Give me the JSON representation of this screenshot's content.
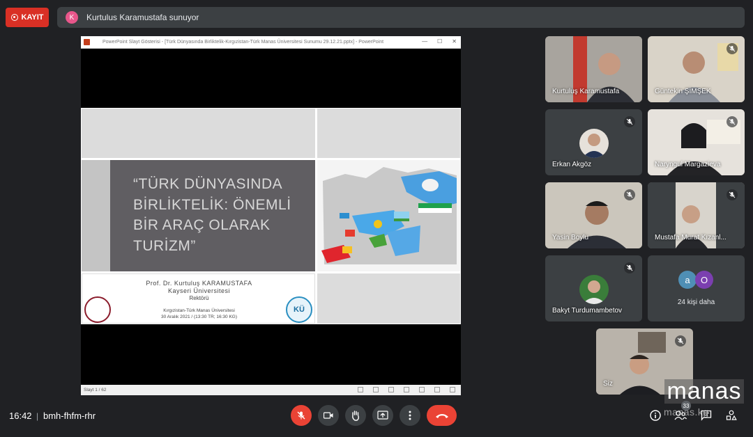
{
  "recording": {
    "label": "KAYIT"
  },
  "presenter": {
    "initial": "K",
    "text": "Kurtulus Karamustafa sunuyor"
  },
  "presentation": {
    "window_title": "PowerPoint Slayt Gösterisi - [Türk Dünyasında Birliktelik-Kırgızistan-Türk Manas Üniversitesi Sunumu 29.12.21.pptx] - PowerPoint",
    "slide_title": "“TÜRK DÜNYASINDA BİRLİKTELİK: ÖNEMLİ BİR ARAÇ OLARAK TURİZM”",
    "author": "Prof. Dr. Kurtuluş KARAMUSTAFA",
    "university": "Kayseri Üniversitesi",
    "role": "Rektörü",
    "venue": "Kırgızistan-Türk Manas Üniversitesi",
    "date": "30 Aralık 2021 / (13:30 TR; 16:30 KG)",
    "slide_counter": "Slayt 1 / 62"
  },
  "participants": [
    {
      "name": "Kurtuluş Karamustafa",
      "muted": false,
      "type": "video"
    },
    {
      "name": "Güntekin ŞİMŞEK",
      "muted": true,
      "type": "video"
    },
    {
      "name": "Erkan Akgöz",
      "muted": true,
      "type": "avatar"
    },
    {
      "name": "Naryngul Margazieva",
      "muted": true,
      "type": "video"
    },
    {
      "name": "Yasin Boylu",
      "muted": true,
      "type": "video"
    },
    {
      "name": "Mustafa Murat Kızanl...",
      "muted": true,
      "type": "video"
    },
    {
      "name": "Bakyt Turdumambetov",
      "muted": true,
      "type": "avatar"
    }
  ],
  "more": {
    "avatars": [
      "a",
      "O"
    ],
    "text": "24 kişi daha"
  },
  "self": {
    "name": "Siz",
    "muted": true
  },
  "bottom": {
    "time": "16:42",
    "separator": "|",
    "meeting_code": "bmh-fhfm-rhr",
    "people_count": "33"
  },
  "watermark": {
    "text": "manas",
    "sub": "manas.kg"
  },
  "colors": {
    "background": "#202124",
    "tile": "#3c4043",
    "danger": "#ea4335",
    "record": "#d93025"
  }
}
